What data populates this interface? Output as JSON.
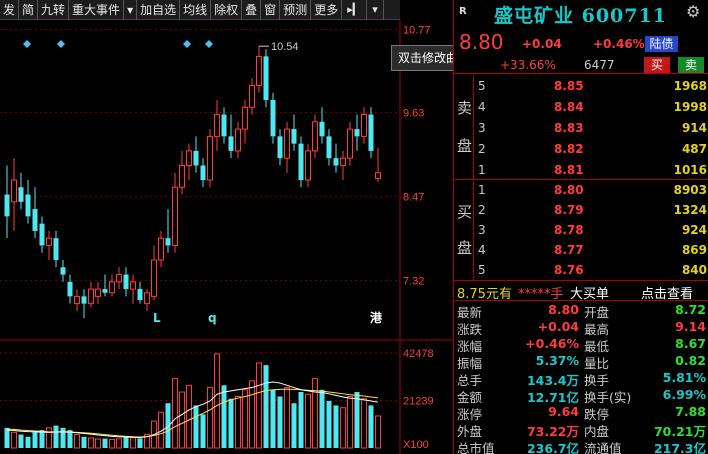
{
  "toolbar": {
    "items": [
      "发",
      "简",
      "九转",
      "重大事件",
      "▾",
      "加自选",
      "均线",
      "除权",
      "叠",
      "窗",
      "预测",
      "更多"
    ],
    "arrow": "▸▎",
    "menu": "▾"
  },
  "tooltip": "双击修改曲线参数",
  "stock": {
    "flag": "R",
    "name": "盛屯矿业 600711",
    "price": "8.80",
    "change": "+0.04",
    "change_pct": "+0.46%",
    "connect_badge": "陆债",
    "weibi": "+33.66%",
    "weicha": "6477",
    "buy_label": "买",
    "sell_label": "卖"
  },
  "asks_side": [
    "卖",
    "盘"
  ],
  "asks": [
    {
      "level": "5",
      "price": "8.85",
      "vol": "1968"
    },
    {
      "level": "4",
      "price": "8.84",
      "vol": "1998"
    },
    {
      "level": "3",
      "price": "8.83",
      "vol": "914"
    },
    {
      "level": "2",
      "price": "8.82",
      "vol": "487"
    },
    {
      "level": "1",
      "price": "8.81",
      "vol": "1016"
    }
  ],
  "bids_side": [
    "买",
    "盘"
  ],
  "bids": [
    {
      "level": "1",
      "price": "8.80",
      "vol": "8903"
    },
    {
      "level": "2",
      "price": "8.79",
      "vol": "1324"
    },
    {
      "level": "3",
      "price": "8.78",
      "vol": "924"
    },
    {
      "level": "4",
      "price": "8.77",
      "vol": "869"
    },
    {
      "level": "5",
      "price": "8.76",
      "vol": "840"
    }
  ],
  "bigorder": {
    "price": "8.75元有",
    "masked": "*****手",
    "label": "大买单",
    "link": "点击查看"
  },
  "stats": [
    {
      "k1": "最新",
      "v1": "8.80",
      "c1": "red",
      "k2": "开盘",
      "v2": "8.72",
      "c2": "green"
    },
    {
      "k1": "涨跌",
      "v1": "+0.04",
      "c1": "red",
      "k2": "最高",
      "v2": "9.14",
      "c2": "red"
    },
    {
      "k1": "涨幅",
      "v1": "+0.46%",
      "c1": "red",
      "k2": "最低",
      "v2": "8.67",
      "c2": "green"
    },
    {
      "k1": "振幅",
      "v1": "5.37%",
      "c1": "cyan",
      "k2": "量比",
      "v2": "0.82",
      "c2": "green"
    },
    {
      "k1": "总手",
      "v1": "143.4万",
      "c1": "cyan",
      "k2": "换手",
      "v2": "5.81%",
      "c2": "cyan"
    },
    {
      "k1": "金额",
      "v1": "12.71亿",
      "c1": "cyan",
      "k2": "换手(实)",
      "v2": "6.99%",
      "c2": "cyan"
    },
    {
      "k1": "涨停",
      "v1": "9.64",
      "c1": "red",
      "k2": "跌停",
      "v2": "7.88",
      "c2": "green"
    },
    {
      "k1": "外盘",
      "v1": "73.22万",
      "c1": "red",
      "k2": "内盘",
      "v2": "70.21万",
      "c2": "green"
    },
    {
      "k1": "总市值",
      "v1": "236.7亿",
      "c1": "cyan",
      "k2": "流通值",
      "v2": "217.3亿",
      "c2": "cyan"
    }
  ],
  "chart_data": {
    "type": "candlestick",
    "price_axis": {
      "ylim": [
        6.5,
        10.9
      ],
      "ticks": [
        "10.77",
        "9.63",
        "8.47",
        "7.32"
      ]
    },
    "volume_axis": {
      "ylim": [
        0,
        46000
      ],
      "ticks": [
        "42478",
        "21239"
      ],
      "unit": "X100"
    },
    "annotations": {
      "max_label": "10.54",
      "markers": [
        "L",
        "q",
        "港"
      ]
    },
    "colors": {
      "up": "#ff3c3c",
      "down": "#4fe8f0",
      "ma": "#ffffff",
      "ma2": "#ffe04a"
    },
    "candles": [
      {
        "o": 8.5,
        "h": 8.9,
        "l": 7.9,
        "c": 8.2
      },
      {
        "o": 8.4,
        "h": 9.0,
        "l": 8.0,
        "c": 8.7
      },
      {
        "o": 8.6,
        "h": 8.8,
        "l": 8.3,
        "c": 8.4
      },
      {
        "o": 8.5,
        "h": 8.7,
        "l": 8.1,
        "c": 8.2
      },
      {
        "o": 8.3,
        "h": 8.6,
        "l": 7.9,
        "c": 8.0
      },
      {
        "o": 8.1,
        "h": 8.2,
        "l": 7.7,
        "c": 7.8
      },
      {
        "o": 7.8,
        "h": 8.0,
        "l": 7.6,
        "c": 7.9
      },
      {
        "o": 7.9,
        "h": 8.0,
        "l": 7.5,
        "c": 7.6
      },
      {
        "o": 7.5,
        "h": 7.6,
        "l": 7.3,
        "c": 7.4
      },
      {
        "o": 7.3,
        "h": 7.4,
        "l": 7.0,
        "c": 7.1
      },
      {
        "o": 7.0,
        "h": 7.2,
        "l": 6.9,
        "c": 7.1
      },
      {
        "o": 7.1,
        "h": 7.2,
        "l": 6.8,
        "c": 7.0
      },
      {
        "o": 7.0,
        "h": 7.3,
        "l": 6.95,
        "c": 7.2
      },
      {
        "o": 7.1,
        "h": 7.3,
        "l": 7.0,
        "c": 7.2
      },
      {
        "o": 7.2,
        "h": 7.4,
        "l": 7.1,
        "c": 7.15
      },
      {
        "o": 7.15,
        "h": 7.4,
        "l": 7.1,
        "c": 7.3
      },
      {
        "o": 7.3,
        "h": 7.5,
        "l": 7.2,
        "c": 7.4
      },
      {
        "o": 7.4,
        "h": 7.5,
        "l": 7.1,
        "c": 7.2
      },
      {
        "o": 7.2,
        "h": 7.4,
        "l": 7.0,
        "c": 7.3
      },
      {
        "o": 7.2,
        "h": 7.3,
        "l": 7.0,
        "c": 7.05
      },
      {
        "o": 7.0,
        "h": 7.2,
        "l": 6.9,
        "c": 7.15
      },
      {
        "o": 7.1,
        "h": 7.8,
        "l": 7.05,
        "c": 7.6
      },
      {
        "o": 7.6,
        "h": 8.0,
        "l": 7.5,
        "c": 7.9
      },
      {
        "o": 7.9,
        "h": 8.3,
        "l": 7.7,
        "c": 7.8
      },
      {
        "o": 7.8,
        "h": 8.8,
        "l": 7.7,
        "c": 8.6
      },
      {
        "o": 8.6,
        "h": 9.1,
        "l": 8.5,
        "c": 8.9
      },
      {
        "o": 8.9,
        "h": 9.2,
        "l": 8.7,
        "c": 9.1
      },
      {
        "o": 9.1,
        "h": 9.3,
        "l": 8.8,
        "c": 8.9
      },
      {
        "o": 8.9,
        "h": 9.0,
        "l": 8.6,
        "c": 8.7
      },
      {
        "o": 8.7,
        "h": 9.4,
        "l": 8.6,
        "c": 9.3
      },
      {
        "o": 9.3,
        "h": 9.8,
        "l": 9.1,
        "c": 9.6
      },
      {
        "o": 9.6,
        "h": 9.7,
        "l": 9.2,
        "c": 9.3
      },
      {
        "o": 9.3,
        "h": 9.6,
        "l": 9.0,
        "c": 9.1
      },
      {
        "o": 9.1,
        "h": 9.5,
        "l": 9.0,
        "c": 9.4
      },
      {
        "o": 9.4,
        "h": 9.8,
        "l": 9.2,
        "c": 9.7
      },
      {
        "o": 9.7,
        "h": 10.1,
        "l": 9.6,
        "c": 10.0
      },
      {
        "o": 10.0,
        "h": 10.54,
        "l": 9.9,
        "c": 10.4
      },
      {
        "o": 10.4,
        "h": 10.5,
        "l": 9.7,
        "c": 9.8
      },
      {
        "o": 9.8,
        "h": 9.9,
        "l": 9.2,
        "c": 9.3
      },
      {
        "o": 9.3,
        "h": 9.4,
        "l": 8.9,
        "c": 9.0
      },
      {
        "o": 9.0,
        "h": 9.5,
        "l": 8.8,
        "c": 9.4
      },
      {
        "o": 9.4,
        "h": 9.6,
        "l": 9.1,
        "c": 9.2
      },
      {
        "o": 9.2,
        "h": 9.3,
        "l": 8.6,
        "c": 8.7
      },
      {
        "o": 8.7,
        "h": 9.2,
        "l": 8.6,
        "c": 9.1
      },
      {
        "o": 9.1,
        "h": 9.6,
        "l": 9.0,
        "c": 9.5
      },
      {
        "o": 9.5,
        "h": 9.7,
        "l": 9.2,
        "c": 9.3
      },
      {
        "o": 9.3,
        "h": 9.4,
        "l": 8.9,
        "c": 9.0
      },
      {
        "o": 9.0,
        "h": 9.2,
        "l": 8.8,
        "c": 8.9
      },
      {
        "o": 8.9,
        "h": 9.1,
        "l": 8.7,
        "c": 9.0
      },
      {
        "o": 9.0,
        "h": 9.5,
        "l": 8.9,
        "c": 9.4
      },
      {
        "o": 9.4,
        "h": 9.6,
        "l": 9.1,
        "c": 9.3
      },
      {
        "o": 9.3,
        "h": 9.7,
        "l": 9.2,
        "c": 9.6
      },
      {
        "o": 9.6,
        "h": 9.7,
        "l": 9.0,
        "c": 9.1
      },
      {
        "o": 8.72,
        "h": 9.14,
        "l": 8.67,
        "c": 8.8
      }
    ],
    "volumes": [
      9000,
      7000,
      6000,
      5000,
      7000,
      8000,
      9000,
      10000,
      9000,
      8000,
      6000,
      5000,
      4500,
      4000,
      4200,
      3800,
      4100,
      5000,
      4600,
      4300,
      6000,
      12000,
      16000,
      20000,
      31000,
      25000,
      28000,
      19000,
      15000,
      27000,
      42000,
      28000,
      22000,
      23000,
      26000,
      30000,
      38000,
      37000,
      26000,
      23000,
      27000,
      20000,
      25000,
      24000,
      31000,
      26000,
      21000,
      19000,
      18000,
      23000,
      25000,
      22000,
      19000,
      14300
    ],
    "ma_volume": [
      8000,
      7800,
      7500,
      7300,
      7200,
      7100,
      7000,
      7100,
      7200,
      7000,
      6800,
      6500,
      6200,
      5800,
      5500,
      5200,
      5000,
      4900,
      4800,
      4700,
      5000,
      6000,
      7500,
      9500,
      13000,
      15000,
      17000,
      18500,
      19500,
      21000,
      24000,
      25000,
      25500,
      26000,
      26500,
      27000,
      28000,
      29000,
      29500,
      29000,
      28000,
      27000,
      26000,
      25500,
      25000,
      24800,
      24200,
      23500,
      22800,
      22300,
      22000,
      21500,
      21000,
      20500
    ],
    "ma_volume2": [
      8500,
      8300,
      8000,
      7800,
      7600,
      7400,
      7200,
      7200,
      7300,
      7200,
      7000,
      6800,
      6600,
      6300,
      6000,
      5700,
      5400,
      5200,
      5000,
      4900,
      5100,
      5600,
      6400,
      7600,
      9500,
      11000,
      12500,
      14000,
      15500,
      17000,
      19000,
      20500,
      21500,
      22300,
      23000,
      23800,
      24800,
      25600,
      26000,
      26200,
      26300,
      26200,
      26000,
      25800,
      25600,
      25400,
      25000,
      24600,
      24200,
      23800,
      23500,
      23200,
      22800,
      22400
    ]
  }
}
